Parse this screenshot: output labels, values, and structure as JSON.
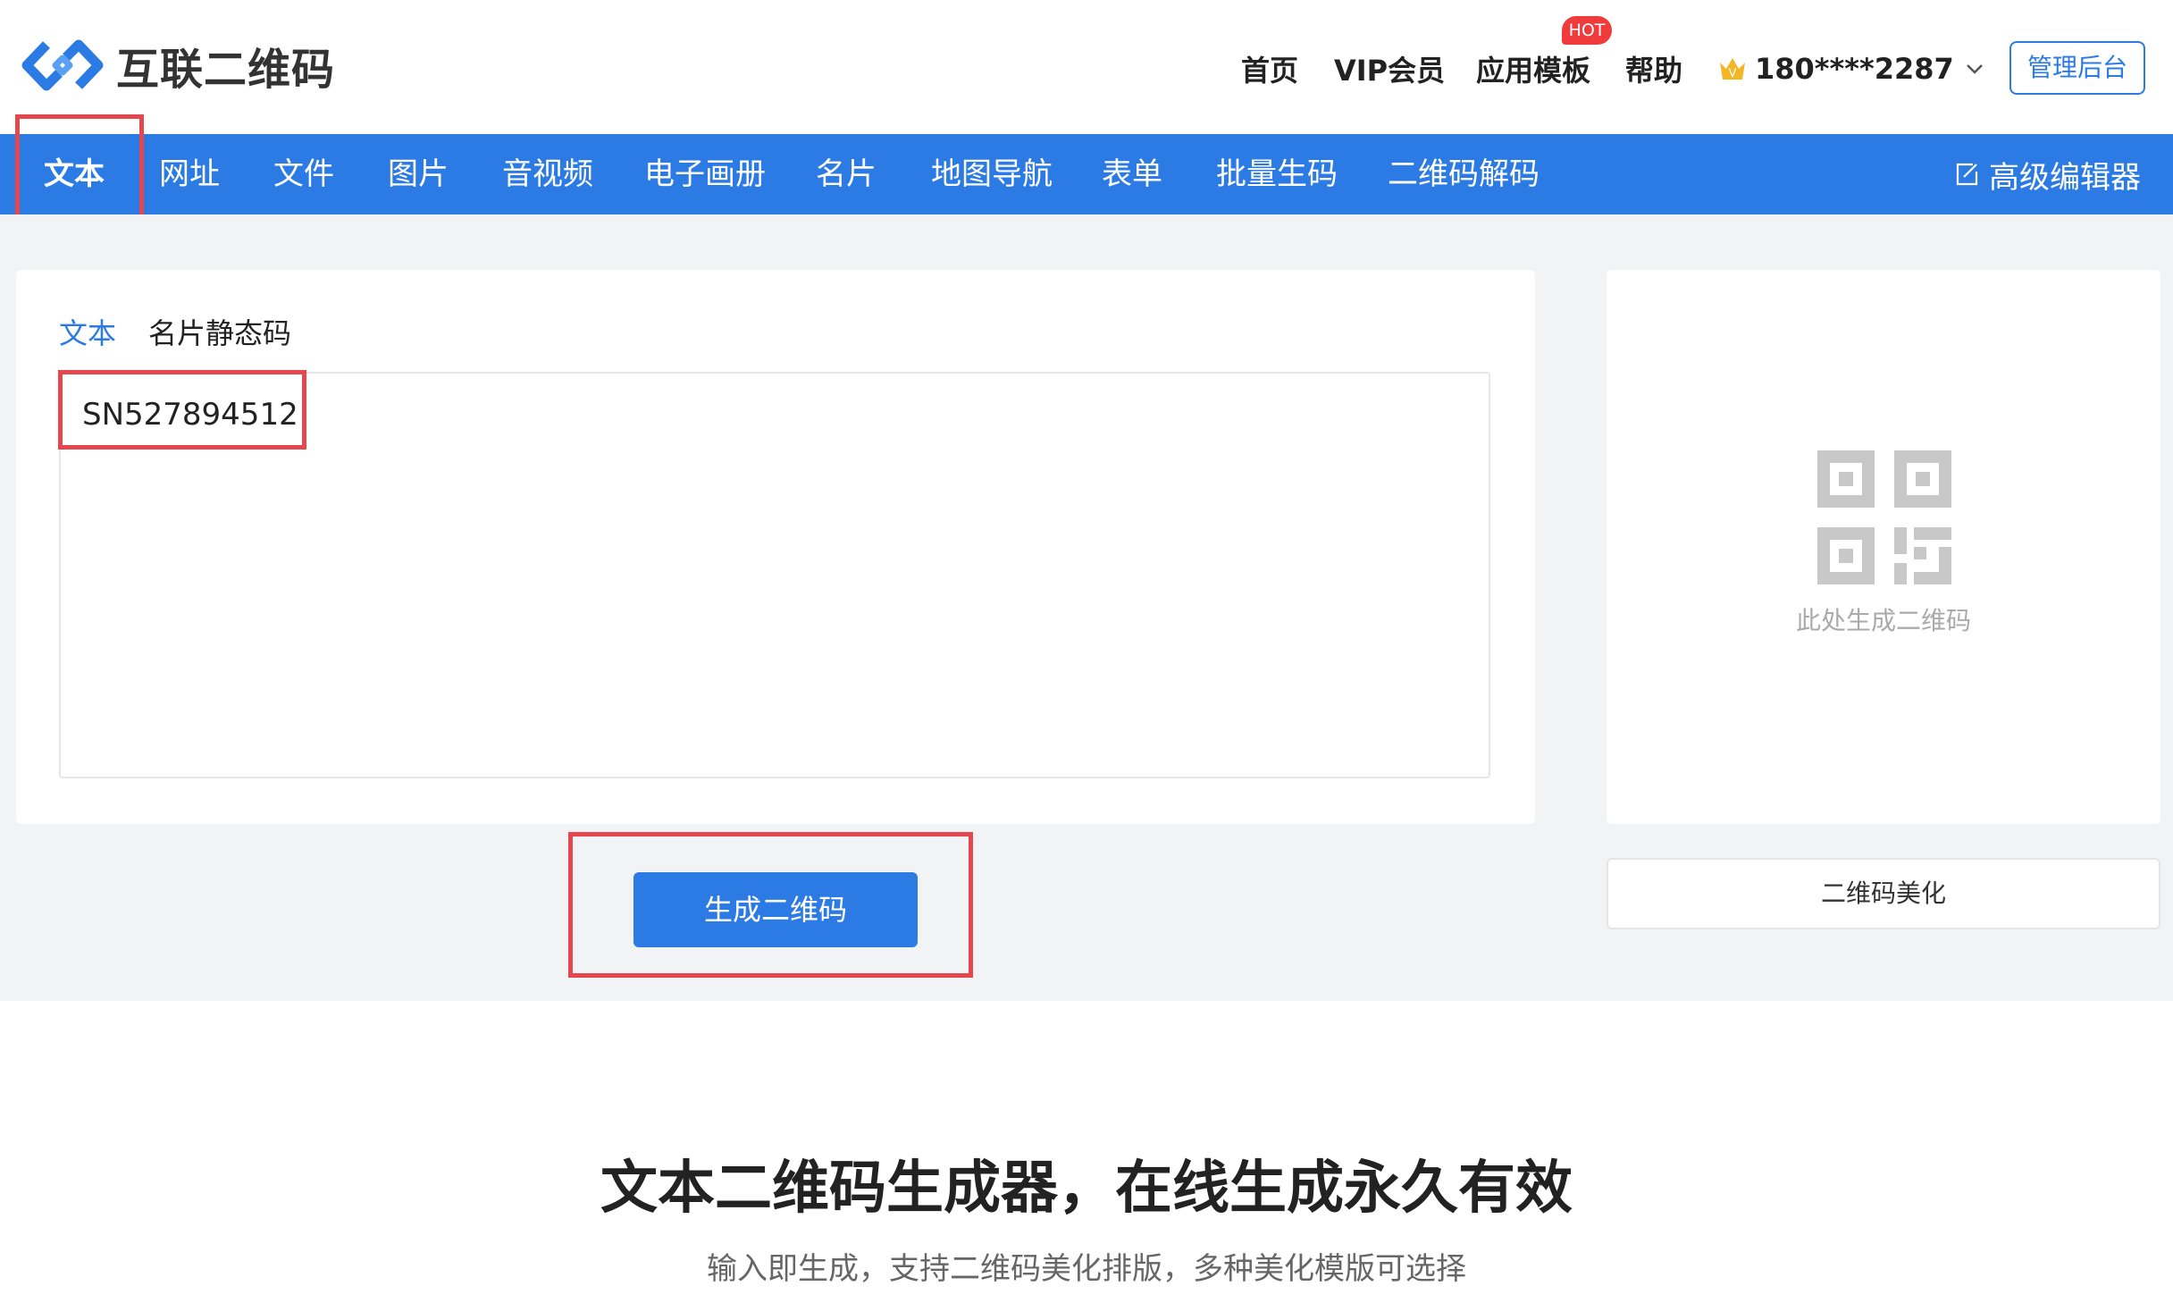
{
  "header": {
    "brand": "互联二维码",
    "nav": [
      {
        "label": "首页"
      },
      {
        "label": "VIP会员"
      },
      {
        "label": "应用模板"
      },
      {
        "label": "帮助"
      }
    ],
    "hot_badge": "HOT",
    "user_phone": "180****2287",
    "admin_button": "管理后台",
    "icons": {
      "logo": "link-logo-icon",
      "vip": "crown-icon",
      "dropdown": "chevron-down-icon"
    }
  },
  "navbar": {
    "tabs": [
      {
        "label": "文本",
        "active": true
      },
      {
        "label": "网址"
      },
      {
        "label": "文件"
      },
      {
        "label": "图片"
      },
      {
        "label": "音视频"
      },
      {
        "label": "电子画册"
      },
      {
        "label": "名片"
      },
      {
        "label": "地图导航"
      },
      {
        "label": "表单"
      },
      {
        "label": "批量生码"
      },
      {
        "label": "二维码解码"
      }
    ],
    "editor_link": "高级编辑器"
  },
  "editor": {
    "subtabs": [
      {
        "label": "文本",
        "active": true
      },
      {
        "label": "名片静态码"
      }
    ],
    "text_value": "SN527894512",
    "generate_button": "生成二维码"
  },
  "preview": {
    "placeholder": "此处生成二维码",
    "beautify_button": "二维码美化"
  },
  "hero": {
    "title": "文本二维码生成器，在线生成永久有效",
    "subtitle": "输入即生成，支持二维码美化排版，多种美化模版可选择"
  },
  "colors": {
    "accent": "#2c7be5",
    "highlight": "#e5474f",
    "hot": "#ef3b3b",
    "background": "#f2f3f5"
  }
}
